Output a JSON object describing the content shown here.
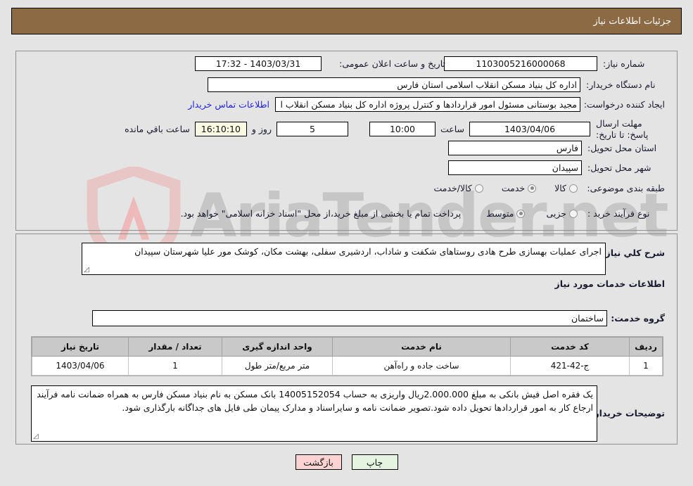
{
  "header": {
    "title": "جزئیات اطلاعات نیاز",
    "bg_color": "#8c6b44",
    "text_color": "#ffffff"
  },
  "watermark": {
    "text": "AriaTender.net",
    "shield_color": "#e8c4c4"
  },
  "top_panel": {
    "need_number": {
      "label": "شماره نیاز:",
      "value": "1103005216000068"
    },
    "announce_datetime": {
      "label": "تاریخ و ساعت اعلان عمومی:",
      "value": "1403/03/31 - 17:32"
    },
    "buyer_org": {
      "label": "نام دستگاه خریدار:",
      "value": "اداره کل بنیاد مسکن انقلاب اسلامی استان فارس"
    },
    "requester": {
      "label": "ایجاد کننده درخواست:",
      "value": "مجید بوستانی مسئول امور قراردادها و کنترل پروژه اداره کل بنیاد مسکن انقلاب ا",
      "contact_link": "اطلاعات تماس خریدار"
    },
    "deadline": {
      "label": "مهلت ارسال پاسخ: تا تاریخ:",
      "date": "1403/04/06",
      "hour_label": "ساعت",
      "hour": "10:00",
      "days_remaining": "5",
      "days_label": "روز و",
      "time_remaining": "16:10:10",
      "remaining_suffix": "ساعت باقي مانده"
    },
    "province": {
      "label": "استان محل تحویل:",
      "value": "فارس"
    },
    "city": {
      "label": "شهر محل تحویل:",
      "value": "سپیدان"
    },
    "subject_category": {
      "label": "طبقه بندی موضوعی:",
      "options": [
        "کالا",
        "خدمت",
        "کالا/خدمت"
      ],
      "selected": "خدمت"
    },
    "purchase_type": {
      "label": "نوع فرآیند خرید :",
      "options": [
        "جزیی",
        "متوسط"
      ],
      "selected": "متوسط",
      "note": "پرداخت تمام یا بخشی از مبلغ خرید،از محل \"اسناد خزانه اسلامی\" خواهد بود."
    }
  },
  "bottom_panel": {
    "general_description": {
      "label": "شرح کلي نیاز:",
      "value": "اجرای عملیات بهسازی طرح هادی روستاهای شکفت و شاداب، اردشیری سفلی، بهشت مکان، کوشک مور علیا شهرستان سپیدان"
    },
    "services_heading": "اطلاعات خدمات مورد نیاز",
    "service_group": {
      "label": "گروه خدمت:",
      "value": "ساختمان"
    },
    "table": {
      "columns": [
        "ردیف",
        "کد خدمت",
        "نام خدمت",
        "واحد اندازه گیری",
        "تعداد / مقدار",
        "تاریخ نیاز"
      ],
      "rows": [
        {
          "row_no": "1",
          "service_code": "ج-42-421",
          "service_name": "ساخت جاده و راه‌آهن",
          "unit": "متر مربع/متر طول",
          "quantity": "1",
          "need_date": "1403/04/06"
        }
      ]
    },
    "buyer_notes": {
      "label": "توضیحات خریدار:",
      "value": "یک فقره اصل فیش بانکی به مبلغ 2.000.000ریال واریزی به حساب 14005152054 بانک مسکن به نام بنیاد مسکن فارس به همراه ضمانت نامه فرآیند ارجاع کار به امور قراردادها تحویل داده شود.تصویر ضمانت نامه و سایراسناد و مدارک پیمان طی فایل های جداگانه بارگذاری شود."
    }
  },
  "footer": {
    "print_button": "چاپ",
    "back_button": "بازگشت",
    "print_color": "#e4f4e0",
    "back_color": "#fbd3d3"
  }
}
